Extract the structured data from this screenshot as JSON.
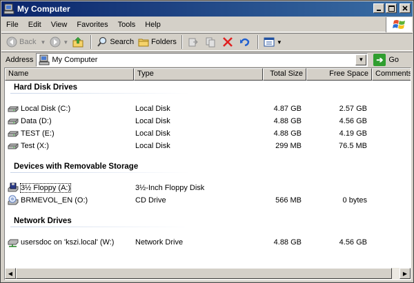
{
  "window": {
    "title": "My Computer"
  },
  "menu": [
    "File",
    "Edit",
    "View",
    "Favorites",
    "Tools",
    "Help"
  ],
  "toolbar": {
    "back": "Back",
    "search": "Search",
    "folders": "Folders"
  },
  "address": {
    "label": "Address",
    "value": "My Computer",
    "go": "Go"
  },
  "columns": [
    "Name",
    "Type",
    "Total Size",
    "Free Space",
    "Comments"
  ],
  "groups": [
    {
      "title": "Hard Disk Drives",
      "items": [
        {
          "name": "Local Disk (C:)",
          "type": "Local Disk",
          "total": "4.87 GB",
          "free": "2.57 GB",
          "icon": "hard-drive-icon"
        },
        {
          "name": "Data (D:)",
          "type": "Local Disk",
          "total": "4.88 GB",
          "free": "4.56 GB",
          "icon": "hard-drive-icon"
        },
        {
          "name": "TEST (E:)",
          "type": "Local Disk",
          "total": "4.88 GB",
          "free": "4.19 GB",
          "icon": "hard-drive-icon"
        },
        {
          "name": "Test (X:)",
          "type": "Local Disk",
          "total": "299 MB",
          "free": "76.5 MB",
          "icon": "hard-drive-icon"
        }
      ]
    },
    {
      "title": "Devices with Removable Storage",
      "items": [
        {
          "name": "3½ Floppy (A:)",
          "type": "3½-Inch Floppy Disk",
          "total": "",
          "free": "",
          "icon": "floppy-drive-icon"
        },
        {
          "name": "BRMEVOL_EN (O:)",
          "type": "CD Drive",
          "total": "566 MB",
          "free": "0 bytes",
          "icon": "cd-drive-icon"
        }
      ]
    },
    {
      "title": "Network Drives",
      "items": [
        {
          "name": "usersdoc on 'kszi.local' (W:)",
          "type": "Network Drive",
          "total": "4.88 GB",
          "free": "4.56 GB",
          "icon": "network-drive-icon"
        }
      ]
    }
  ]
}
